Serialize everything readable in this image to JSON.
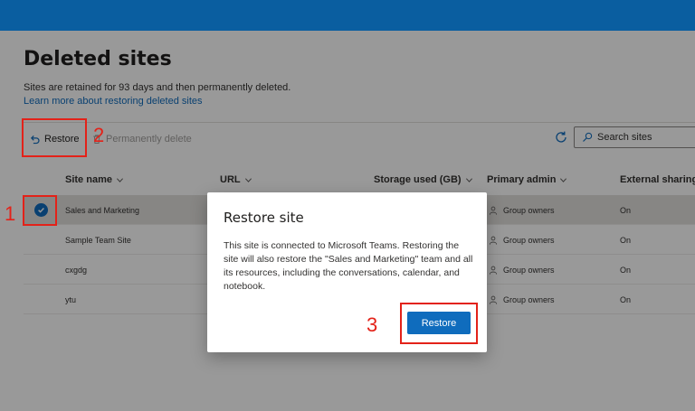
{
  "page": {
    "title": "Deleted sites",
    "retention_text": "Sites are retained for 93 days and then permanently deleted.",
    "learn_link": "Learn more about restoring deleted sites"
  },
  "toolbar": {
    "restore_label": "Restore",
    "restore_icon": "undo-icon",
    "permanently_delete_label": "Permanently delete",
    "permanently_delete_icon": "trash-icon",
    "refresh_icon": "refresh-icon",
    "search_placeholder": "Search sites",
    "search_icon": "search-icon"
  },
  "table": {
    "columns": [
      "Site name",
      "URL",
      "Storage used (GB)",
      "Primary admin",
      "External sharing"
    ],
    "rows": [
      {
        "site_name": "Sales and Marketing",
        "primary_admin": "Group owners",
        "external_sharing": "On",
        "selected": true
      },
      {
        "site_name": "Sample Team Site",
        "primary_admin": "Group owners",
        "external_sharing": "On",
        "selected": false
      },
      {
        "site_name": "cxgdg",
        "primary_admin": "Group owners",
        "external_sharing": "On",
        "selected": false
      },
      {
        "site_name": "ytu",
        "primary_admin": "Group owners",
        "external_sharing": "On",
        "selected": false
      }
    ]
  },
  "dialog": {
    "title": "Restore site",
    "body": "This site is connected to Microsoft Teams. Restoring the site will also restore the \"Sales and Marketing\" team and all its resources, including the conversations, calendar, and notebook.",
    "restore_button": "Restore"
  },
  "annotations": {
    "step_1": "1",
    "step_2": "2",
    "step_3": "3"
  },
  "colors": {
    "header_bar": "#0a5ea0",
    "accent": "#0f6cbd",
    "annotation_red": "#e32219"
  }
}
